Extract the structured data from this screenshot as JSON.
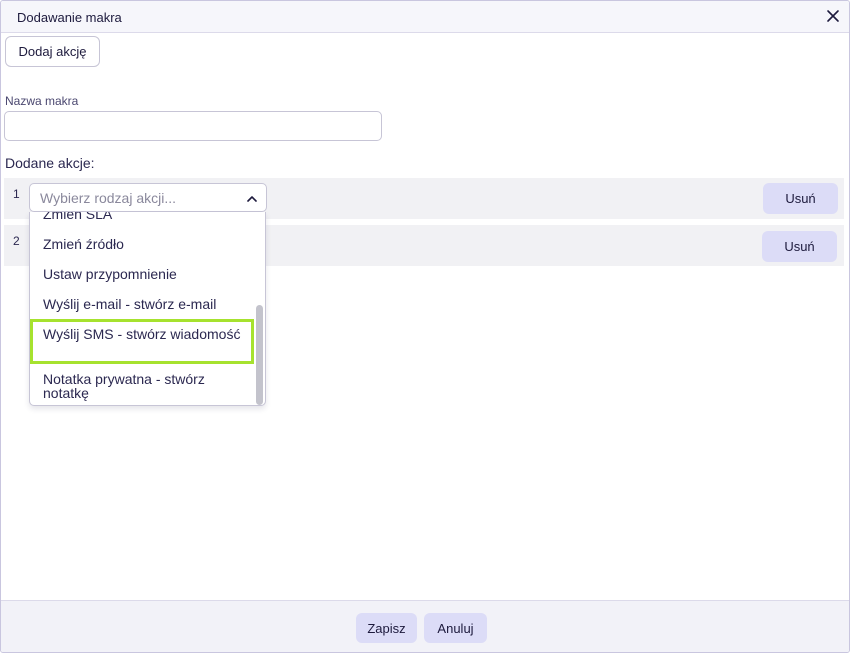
{
  "dialog": {
    "title": "Dodawanie makra",
    "close_icon": "close-icon"
  },
  "toolbar": {
    "add_action_label": "Dodaj akcję"
  },
  "form": {
    "name_label": "Nazwa makra",
    "name_value": "",
    "added_actions_label": "Dodane akcje:"
  },
  "actions": [
    {
      "number": "1",
      "select_placeholder": "Wybierz rodzaj akcji...",
      "remove_label": "Usuń"
    },
    {
      "number": "2",
      "remove_label": "Usuń"
    }
  ],
  "dropdown": {
    "options": [
      "Zmień SLA",
      "Zmień źródło",
      "Ustaw przypomnienie",
      "Wyślij e-mail - stwórz e-mail",
      "Wyślij SMS - stwórz wiadomość",
      "Notatka prywatna - stwórz notatkę"
    ],
    "highlighted_index": 4,
    "highlight_color": "#a6e22e"
  },
  "footer": {
    "save_label": "Zapisz",
    "cancel_label": "Anuluj"
  },
  "colors": {
    "accent_button": "#dcdcf7",
    "text": "#1d1a3d"
  }
}
